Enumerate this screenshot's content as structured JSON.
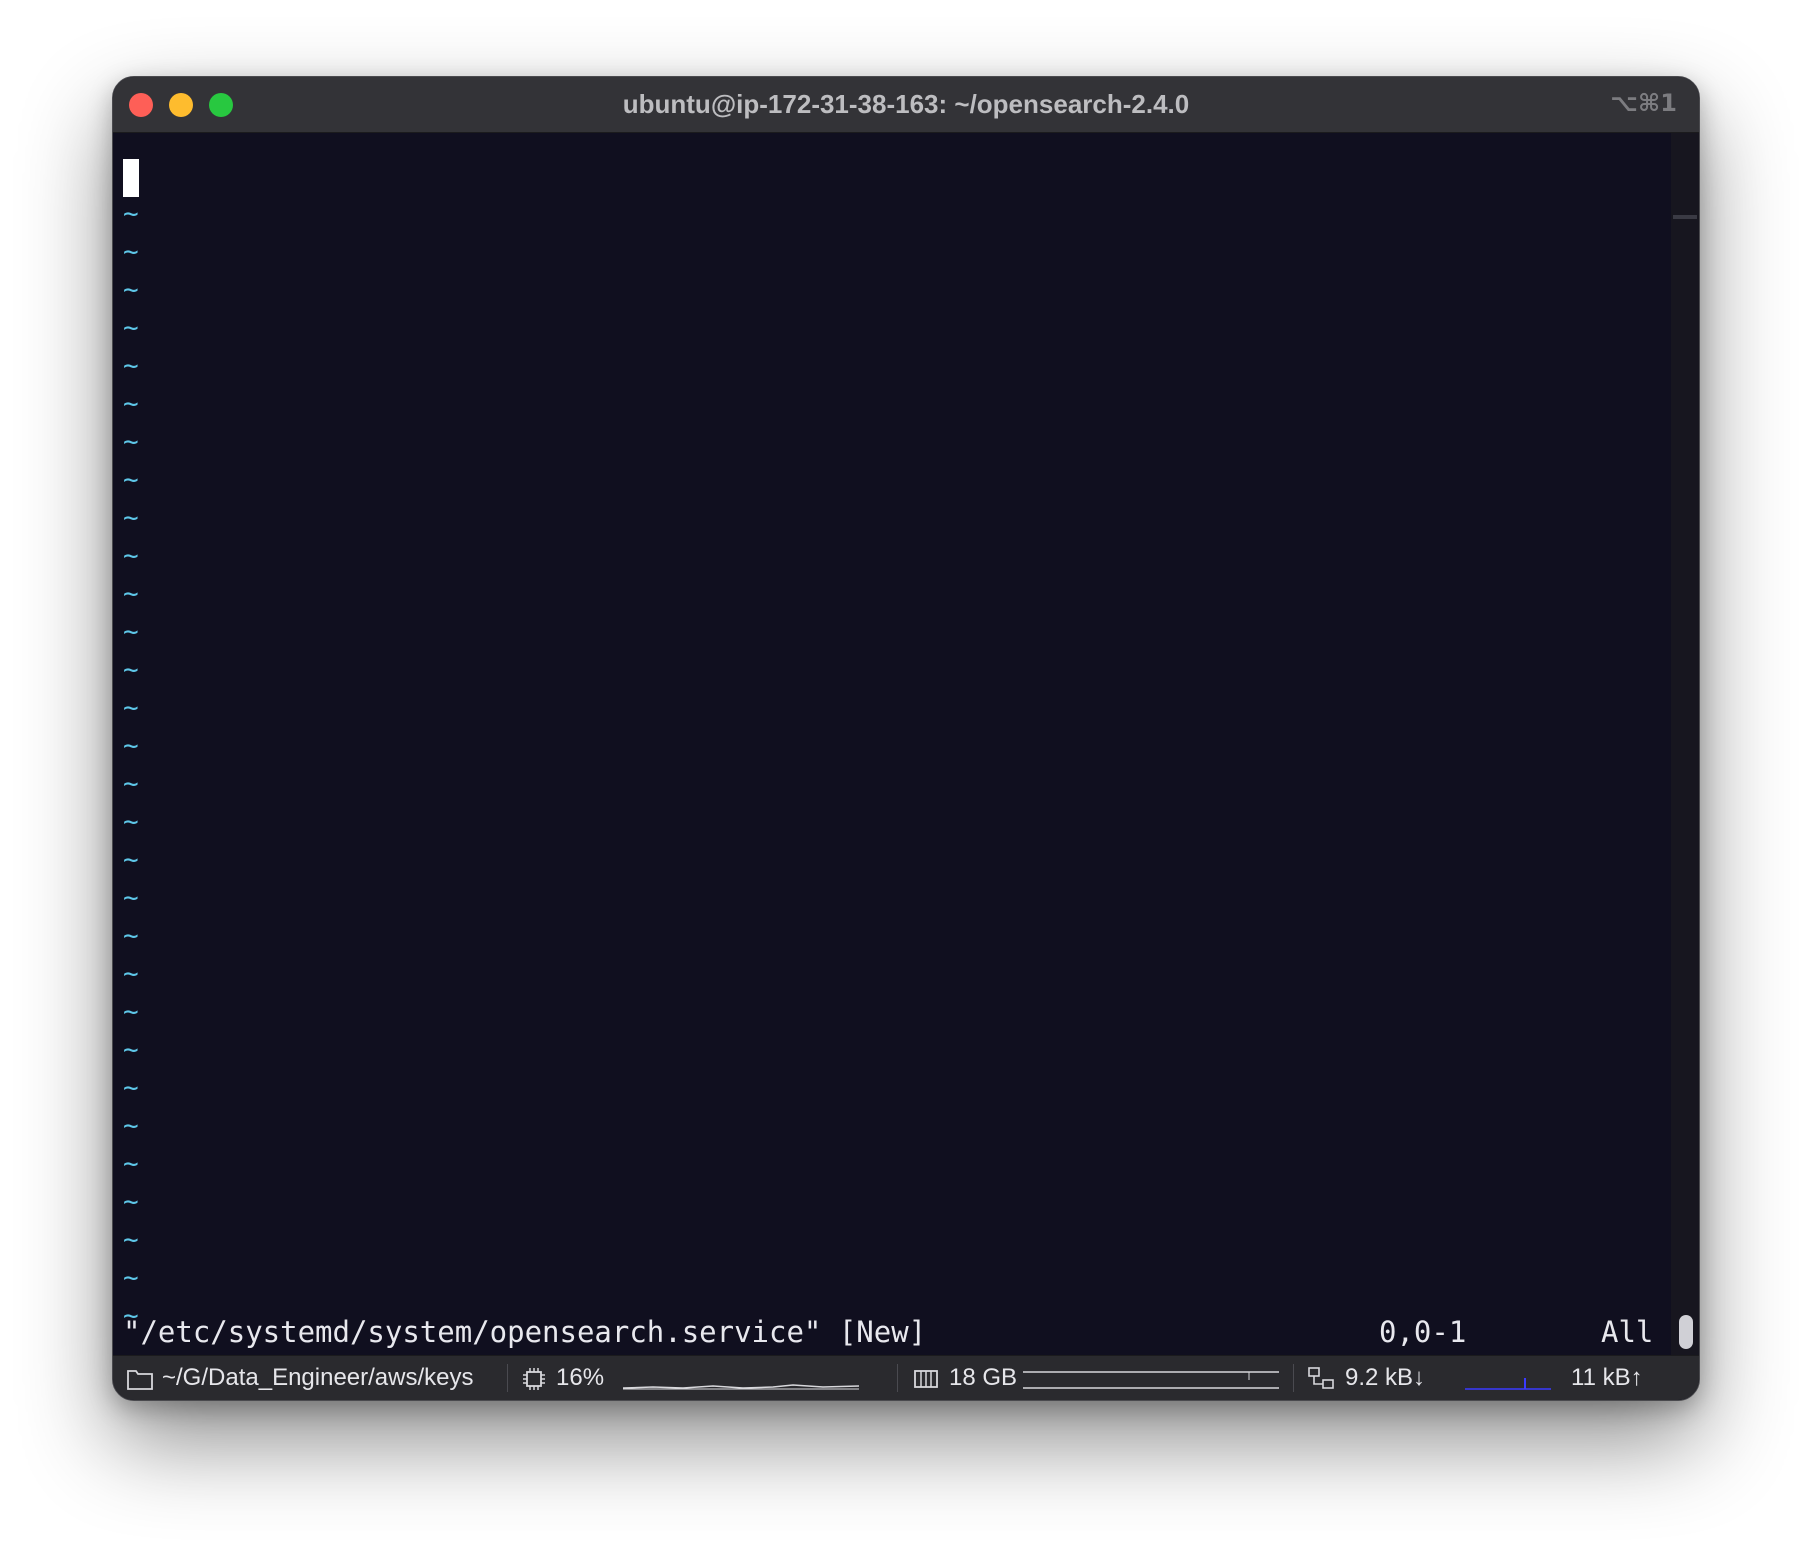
{
  "window": {
    "title": "ubuntu@ip-172-31-38-163: ~/opensearch-2.4.0",
    "shortcut": "⌥⌘1"
  },
  "editor": {
    "empty_line_marker": "~",
    "empty_line_count": 30,
    "file_message": "\"/etc/systemd/system/opensearch.service\" [New]",
    "cursor_position": "0,0-1",
    "scroll_position": "All"
  },
  "statusbar": {
    "path": "~/G/Data_Engineer/aws/keys",
    "cpu": "16%",
    "memory": "18 GB",
    "net_down": "9.2 kB↓",
    "net_up": "11 kB↑",
    "icons": [
      "folder-icon",
      "cpu-icon",
      "memory-icon",
      "network-icon"
    ],
    "colors": {
      "net_graph": "#3a3aff"
    }
  },
  "colors": {
    "terminal_bg": "#100f1f",
    "tilde": "#5ec7e8",
    "close": "#fe5f57",
    "minimize": "#febc2e",
    "zoom": "#28c840"
  }
}
